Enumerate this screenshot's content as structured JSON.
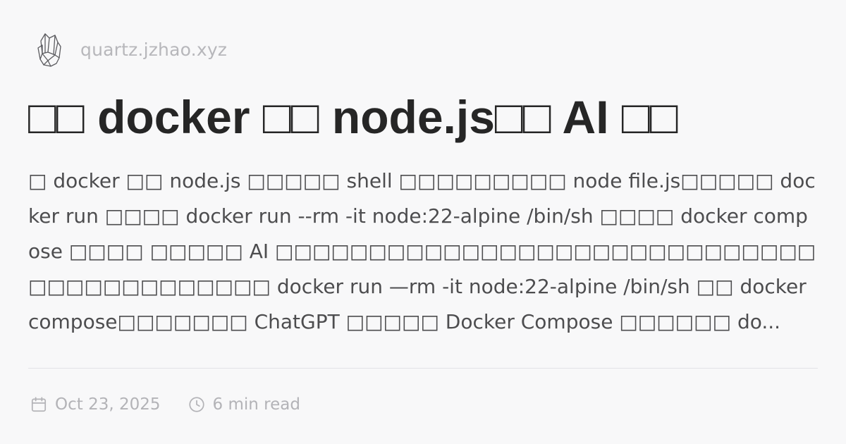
{
  "site": {
    "logo_icon": "quartz-crystal-logo-icon",
    "name": "quartz.jzhao.xyz"
  },
  "article": {
    "title": "□□ docker □□ node.js□□ AI □□",
    "description": "□ docker □□ node.js □□□□□ shell □□□□□□□□□ node file.js□□□□□ docker run □□□□ docker run --rm -it node:22-alpine /bin/sh □□□□ docker compose □□□□ □□□□□ AI □□□□□□□□□□□□□□□□□□□□□□□□□□□□□□□□□□□□□□□□□□ docker run —rm -it node:22-alpine /bin/sh □□ docker compose□□□□□□□ ChatGPT □□□□□ Docker Compose □□□□□□ do..."
  },
  "meta": {
    "date_icon": "calendar-icon",
    "date": "Oct 23, 2025",
    "reading_icon": "clock-icon",
    "reading_time": "6 min read"
  },
  "colors": {
    "background": "#f8f8f9",
    "title": "#262626",
    "body_text": "#4d4d4f",
    "muted": "#b3b3b7",
    "divider": "#e3e3e6"
  }
}
